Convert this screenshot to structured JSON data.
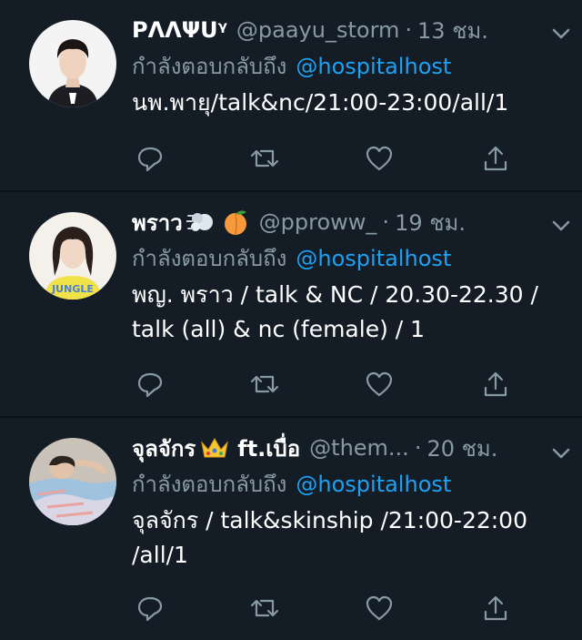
{
  "colors": {
    "background": "#141d26",
    "divider": "#0c1116",
    "muted": "#8899a6",
    "link": "#1da1f2",
    "text": "#ffffff"
  },
  "tweets": [
    {
      "display_name": "PΛΛΨUᵞ",
      "emoji": [],
      "handle": "@paayu_storm",
      "separator": "·",
      "time": "13 ชม.",
      "reply_prefix": "กำลังตอบกลับถึง",
      "reply_to": "@hospitalhost",
      "text": "นพ.พายุ/talk&nc/21:00-23:00/all/1",
      "avatar_icon": "avatar-man-icon"
    },
    {
      "display_name": "พราว",
      "emoji": [
        "dash-emoji",
        "peach-emoji"
      ],
      "handle": "@pproww_",
      "separator": "·",
      "time": "19 ชม.",
      "reply_prefix": "กำลังตอบกลับถึง",
      "reply_to": "@hospitalhost",
      "text": "พญ. พราว / talk & NC / 20.30-22.30 / talk (all) & nc (female) / 1",
      "avatar_icon": "avatar-woman-icon"
    },
    {
      "display_name": "จุลจักร",
      "name_suffix": "ft.เบื่อ",
      "emoji": [
        "crown-emoji"
      ],
      "handle": "@them...",
      "separator": "·",
      "time": "20 ชม.",
      "reply_prefix": "กำลังตอบกลับถึง",
      "reply_to": "@hospitalhost",
      "text": "จุลจักร / talk&skinship /21:00-22:00 /all/1",
      "avatar_icon": "avatar-sleeping-person-icon"
    }
  ],
  "action_icons": [
    "reply-icon",
    "retweet-icon",
    "like-icon",
    "share-icon"
  ]
}
